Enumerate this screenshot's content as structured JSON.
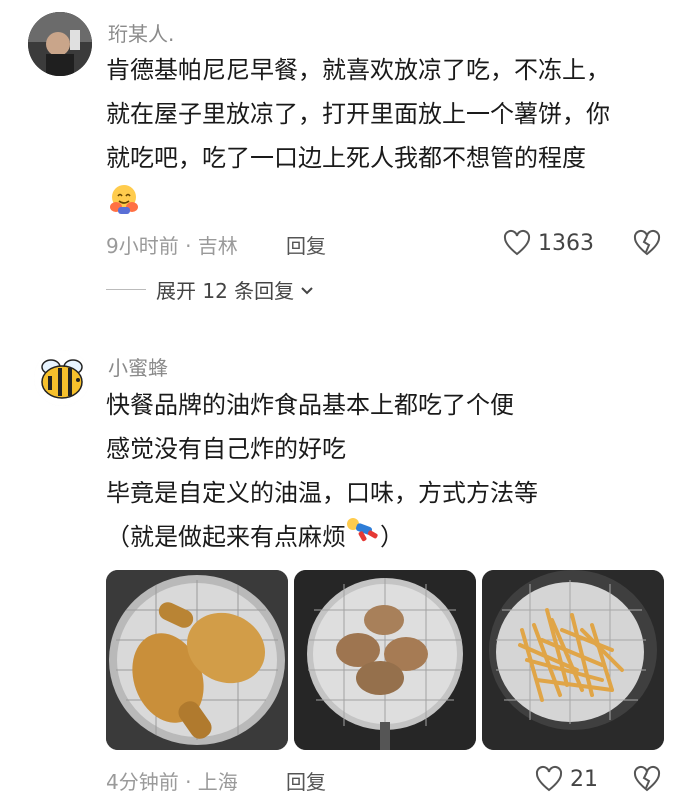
{
  "comments": [
    {
      "username": "珩某人.",
      "lines": [
        "肯德基帕尼尼早餐，就喜欢放凉了吃，不冻上，",
        "就在屋子里放凉了，打开里面放上一个薯饼，你",
        "就吃吧，吃了一口边上死人我都不想管的程度"
      ],
      "emoji_icon": "hugging-face-icon",
      "time_location": "9小时前 · 吉林",
      "reply_label": "回复",
      "likes": "1363",
      "expand_label": "展开 12 条回复"
    },
    {
      "username": "小蜜蜂",
      "lines": [
        "快餐品牌的油炸食品基本上都吃了个便",
        "感觉没有自己炸的好吃",
        "毕竟是自定义的油温，口味，方式方法等",
        "（就是做起来有点麻烦"
      ],
      "line4_end": "）",
      "emoji_icon": "person-fainting-icon",
      "images": [
        "fried-chicken-drumsticks",
        "fried-chicken-pieces",
        "french-fries"
      ],
      "time_location": "4分钟前 · 上海",
      "reply_label": "回复",
      "likes": "21"
    }
  ],
  "colors": {
    "text": "#1a1a1a",
    "meta": "#9a9a9a",
    "accent": "#f0a500"
  }
}
